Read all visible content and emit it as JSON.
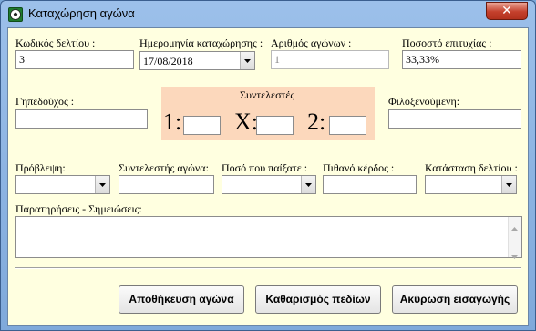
{
  "window": {
    "title": "Καταχώρηση αγώνα",
    "close_label": "✕"
  },
  "fields": {
    "ticket_code": {
      "label": "Κωδικός δελτίου :",
      "value": "3"
    },
    "entry_date": {
      "label": "Ημερομηνία καταχώρησης :",
      "value": "17/08/2018"
    },
    "match_count": {
      "label": "Αριθμός αγώνων :",
      "value": "1"
    },
    "success_rate": {
      "label": "Ποσοστό επιτυχίας :",
      "value": "33,33%"
    },
    "home_team": {
      "label": "Γηπεδούχος :",
      "value": ""
    },
    "away_team": {
      "label": "Φιλοξενούμενη:",
      "value": ""
    },
    "prediction": {
      "label": "Πρόβλεψη:",
      "value": ""
    },
    "match_odds": {
      "label": "Συντελεστής αγώνα:",
      "value": ""
    },
    "stake": {
      "label": "Ποσό που παίξατε :",
      "value": ""
    },
    "potential_win": {
      "label": "Πιθανό κέρδος :",
      "value": ""
    },
    "ticket_status": {
      "label": "Κατάσταση δελτίου :",
      "value": ""
    },
    "notes": {
      "label": "Παρατηρήσεις - Σημειώσεις:",
      "value": ""
    }
  },
  "odds": {
    "title": "Συντελεστές",
    "home_label": "1:",
    "draw_label": "X:",
    "away_label": "2:",
    "home_value": "",
    "draw_value": "",
    "away_value": ""
  },
  "buttons": {
    "save": "Αποθήκευση αγώνα",
    "clear": "Καθαρισμός πεδίων",
    "cancel": "Ακύρωση εισαγωγής"
  },
  "icons": {
    "app": "soccer-ball-icon",
    "dropdown": "chevron-down-icon",
    "scroll_up": "scroll-up-arrow-icon",
    "scroll_down": "scroll-down-arrow-icon"
  },
  "colors": {
    "form_background": "#ffffe0",
    "odds_panel": "#fcd8bc",
    "close_button": "#c4402c",
    "title_bar": "#8fb5e3"
  }
}
